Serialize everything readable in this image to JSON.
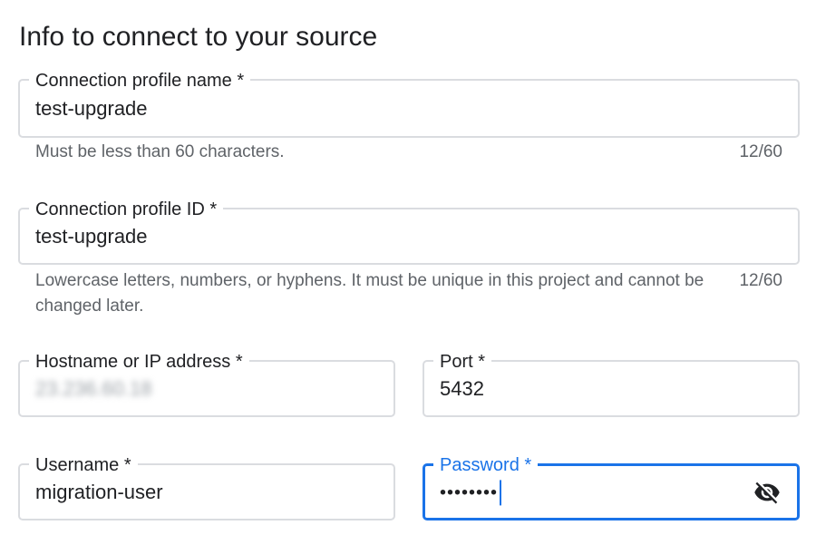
{
  "section": {
    "title": "Info to connect to your source"
  },
  "fields": {
    "profile_name": {
      "label": "Connection profile name *",
      "value": "test-upgrade",
      "hint": "Must be less than 60 characters.",
      "counter": "12/60"
    },
    "profile_id": {
      "label": "Connection profile ID *",
      "value": "test-upgrade",
      "hint": "Lowercase letters, numbers, or hyphens. It must be unique in this project and cannot be changed later.",
      "counter": "12/60"
    },
    "hostname": {
      "label": "Hostname or IP address *",
      "value": "23.236.60.18"
    },
    "port": {
      "label": "Port *",
      "value": "5432"
    },
    "username": {
      "label": "Username *",
      "value": "migration-user"
    },
    "password": {
      "label": "Password *",
      "value": "••••••••",
      "icon": "visibility-off-icon"
    }
  },
  "colors": {
    "focus": "#1a73e8",
    "border": "#dadce0",
    "hint_text": "#5f6368"
  }
}
